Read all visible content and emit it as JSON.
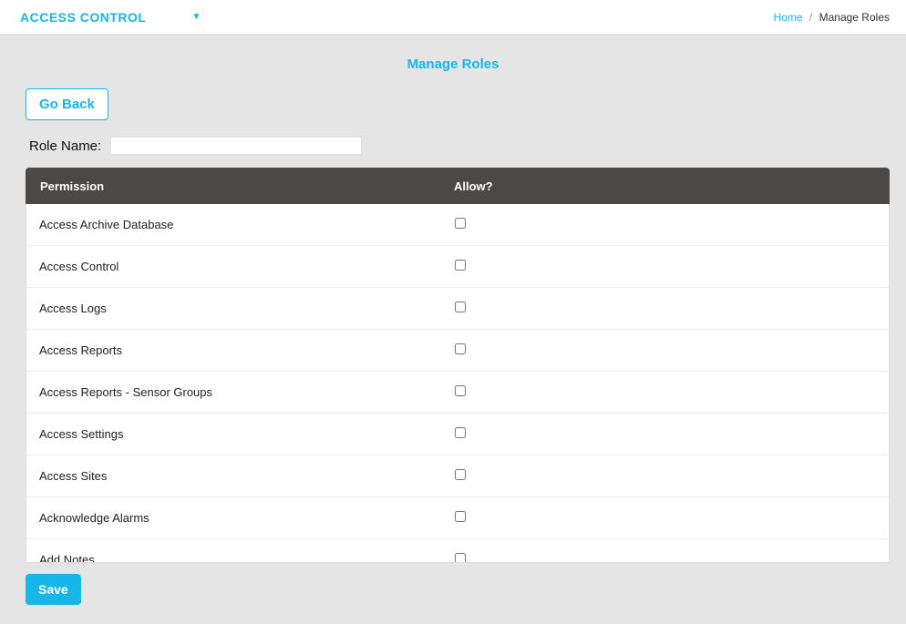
{
  "topbar": {
    "title": "ACCESS CONTROL",
    "dropdown_icon": "▼"
  },
  "breadcrumb": {
    "home": "Home",
    "sep": "/",
    "current": "Manage Roles"
  },
  "page_title": "Manage Roles",
  "buttons": {
    "go_back": "Go Back",
    "save": "Save"
  },
  "form": {
    "role_name_label": "Role Name:",
    "role_name_value": ""
  },
  "table": {
    "headers": {
      "permission": "Permission",
      "allow": "Allow?"
    },
    "rows": [
      {
        "permission": "Access Archive Database",
        "allow": false
      },
      {
        "permission": "Access Control",
        "allow": false
      },
      {
        "permission": "Access Logs",
        "allow": false
      },
      {
        "permission": "Access Reports",
        "allow": false
      },
      {
        "permission": "Access Reports - Sensor Groups",
        "allow": false
      },
      {
        "permission": "Access Settings",
        "allow": false
      },
      {
        "permission": "Access Sites",
        "allow": false
      },
      {
        "permission": "Acknowledge Alarms",
        "allow": false
      },
      {
        "permission": "Add Notes",
        "allow": false
      }
    ]
  }
}
